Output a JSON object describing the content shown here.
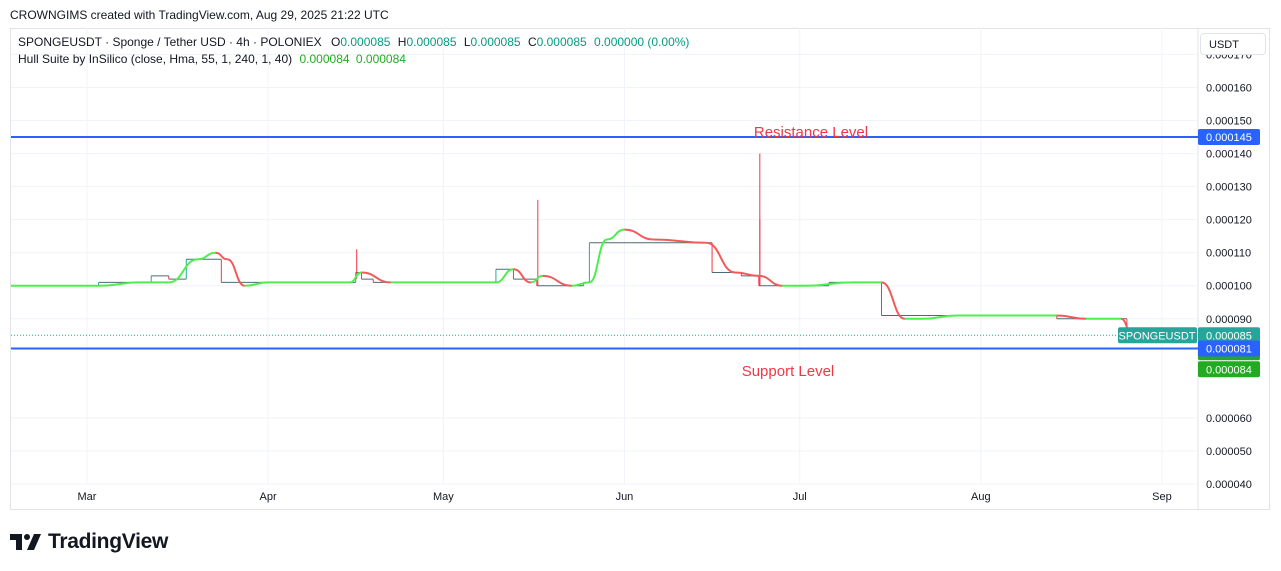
{
  "credit": "CROWNGIMS created with TradingView.com, Aug 29, 2025 21:22 UTC",
  "legend": {
    "symbol_line": "SPONGEUSDT · Sponge / Tether USD · 4h · POLONIEX",
    "o_label": "O",
    "o_value": "0.000085",
    "h_label": "H",
    "h_value": "0.000085",
    "l_label": "L",
    "l_value": "0.000085",
    "c_label": "C",
    "c_value": "0.000085",
    "change": "0.000000 (0.00%)",
    "indicator": "Hull Suite by InSilico (close, Hma, 55, 1, 240, 1, 40)",
    "ind_value_1": "0.000084",
    "ind_value_2": "0.000084"
  },
  "currency": "USDT",
  "brand": "TradingView",
  "colors": {
    "bull": "#22ab94",
    "bear": "#f23645",
    "hull_up": "#4cef4c",
    "hull_down": "#f25a5a",
    "level_line": "#2962ff",
    "annotation": "#f23645",
    "label_green": "#22ab22",
    "label_blue": "#2962ff",
    "label_teal": "#26a69a"
  },
  "chart_data": {
    "type": "line",
    "title": "",
    "ylim": [
      4e-05,
      0.000178
    ],
    "y_ticks": [
      "0.000170",
      "0.000160",
      "0.000150",
      "0.000140",
      "0.000130",
      "0.000120",
      "0.000110",
      "0.000100",
      "0.000090",
      "0.000060",
      "0.000050",
      "0.000040"
    ],
    "x_ticks": [
      "Mar",
      "Apr",
      "May",
      "Jun",
      "Jul",
      "Aug",
      "Sep"
    ],
    "xlim": [
      "2025-02-16",
      "2025-09-07"
    ],
    "x_tick_dates": [
      "2025-03-01",
      "2025-04-01",
      "2025-05-01",
      "2025-06-01",
      "2025-07-01",
      "2025-08-01",
      "2025-09-01"
    ],
    "price_steps": [
      {
        "date": "2025-02-16",
        "value": 0.0001
      },
      {
        "date": "2025-03-03",
        "value": 0.000101
      },
      {
        "date": "2025-03-12",
        "value": 0.000103
      },
      {
        "date": "2025-03-15",
        "value": 0.000102
      },
      {
        "date": "2025-03-18",
        "value": 0.000108
      },
      {
        "date": "2025-03-24",
        "value": 0.000101
      },
      {
        "date": "2025-04-16",
        "value": 0.000104
      },
      {
        "date": "2025-04-17",
        "value": 0.000102
      },
      {
        "date": "2025-04-19",
        "value": 0.000101
      },
      {
        "date": "2025-05-10",
        "value": 0.000105
      },
      {
        "date": "2025-05-13",
        "value": 0.000102
      },
      {
        "date": "2025-05-17",
        "value": 0.0001
      },
      {
        "date": "2025-05-25",
        "value": 0.000101
      },
      {
        "date": "2025-05-26",
        "value": 0.000113
      },
      {
        "date": "2025-06-16",
        "value": 0.000104
      },
      {
        "date": "2025-06-21",
        "value": 0.000103
      },
      {
        "date": "2025-06-24",
        "value": 0.0001
      },
      {
        "date": "2025-07-06",
        "value": 0.000101
      },
      {
        "date": "2025-07-15",
        "value": 9.1e-05
      },
      {
        "date": "2025-08-14",
        "value": 9e-05
      },
      {
        "date": "2025-08-26",
        "value": 8.5e-05
      },
      {
        "date": "2025-08-29",
        "value": 8.5e-05
      }
    ],
    "wicks": [
      {
        "date": "2025-04-16",
        "low": 0.000102,
        "high": 0.000111
      },
      {
        "date": "2025-05-17",
        "low": 0.0001,
        "high": 0.000126
      },
      {
        "date": "2025-06-24",
        "low": 0.0001,
        "high": 0.00012
      },
      {
        "date": "2025-06-24",
        "low": 0.0001,
        "high": 0.00014
      }
    ],
    "hull": [
      {
        "date": "2025-02-16",
        "value": 0.0001
      },
      {
        "date": "2025-03-03",
        "value": 0.0001
      },
      {
        "date": "2025-03-10",
        "value": 0.000101
      },
      {
        "date": "2025-03-15",
        "value": 0.000101
      },
      {
        "date": "2025-03-20",
        "value": 0.000108
      },
      {
        "date": "2025-03-23",
        "value": 0.00011
      },
      {
        "date": "2025-03-25",
        "value": 0.000108
      },
      {
        "date": "2025-03-28",
        "value": 0.0001
      },
      {
        "date": "2025-04-01",
        "value": 0.000101
      },
      {
        "date": "2025-04-15",
        "value": 0.000101
      },
      {
        "date": "2025-04-17",
        "value": 0.000104
      },
      {
        "date": "2025-04-22",
        "value": 0.000101
      },
      {
        "date": "2025-05-10",
        "value": 0.000101
      },
      {
        "date": "2025-05-13",
        "value": 0.000105
      },
      {
        "date": "2025-05-16",
        "value": 0.000101
      },
      {
        "date": "2025-05-18",
        "value": 0.000103
      },
      {
        "date": "2025-05-23",
        "value": 0.0001
      },
      {
        "date": "2025-05-26",
        "value": 0.000101
      },
      {
        "date": "2025-05-29",
        "value": 0.000114
      },
      {
        "date": "2025-06-01",
        "value": 0.000117
      },
      {
        "date": "2025-06-06",
        "value": 0.000114
      },
      {
        "date": "2025-06-15",
        "value": 0.000113
      },
      {
        "date": "2025-06-20",
        "value": 0.000104
      },
      {
        "date": "2025-06-24",
        "value": 0.000103
      },
      {
        "date": "2025-06-28",
        "value": 0.0001
      },
      {
        "date": "2025-07-02",
        "value": 0.0001
      },
      {
        "date": "2025-07-10",
        "value": 0.000101
      },
      {
        "date": "2025-07-15",
        "value": 0.000101
      },
      {
        "date": "2025-07-19",
        "value": 9e-05
      },
      {
        "date": "2025-07-22",
        "value": 9e-05
      },
      {
        "date": "2025-07-28",
        "value": 9.1e-05
      },
      {
        "date": "2025-08-14",
        "value": 9.1e-05
      },
      {
        "date": "2025-08-19",
        "value": 9e-05
      },
      {
        "date": "2025-08-25",
        "value": 9e-05
      },
      {
        "date": "2025-08-27",
        "value": 8.5e-05
      }
    ],
    "levels": [
      {
        "label": "Resistance Level",
        "value": 0.000145,
        "tag": "0.000145"
      },
      {
        "label": "Support Level",
        "value": 8.1e-05,
        "tag": "0.000081"
      }
    ],
    "current_price": {
      "symbol": "SPONGEUSDT",
      "value": 8.5e-05,
      "tag": "0.000085"
    },
    "hull_tags": [
      "0.000084",
      "0.000084"
    ]
  }
}
